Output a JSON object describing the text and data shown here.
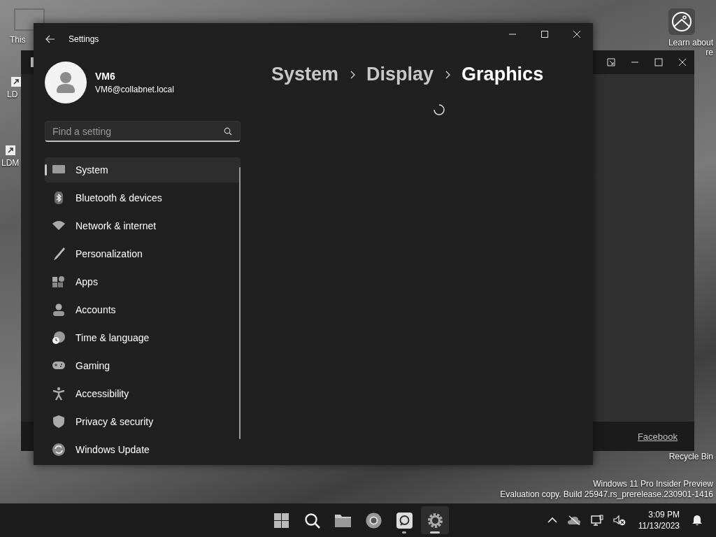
{
  "desktop": {
    "icons": [
      {
        "kind": "pc",
        "lines": [
          "This"
        ]
      },
      {
        "kind": "shortcut",
        "lines": [
          "LD"
        ]
      },
      {
        "kind": "shortcut",
        "lines": [
          "LDM"
        ]
      },
      {
        "kind": "spotlight",
        "lines": [
          "Learn about",
          "re"
        ]
      },
      {
        "kind": "hidden",
        "lines": [
          "Recycle Bin"
        ]
      }
    ],
    "build_info": [
      "Windows 11 Pro Insider Preview",
      "Evaluation copy. Build 25947.rs_prerelease.230901-1416"
    ]
  },
  "back_window": {
    "link": "Facebook"
  },
  "settings": {
    "title": "Settings",
    "user": {
      "name": "VM6",
      "email": "VM6@collabnet.local"
    },
    "search": {
      "placeholder": "Find a setting"
    },
    "nav": [
      {
        "label": "System",
        "selected": true
      },
      {
        "label": "Bluetooth & devices",
        "selected": false
      },
      {
        "label": "Network & internet",
        "selected": false
      },
      {
        "label": "Personalization",
        "selected": false
      },
      {
        "label": "Apps",
        "selected": false
      },
      {
        "label": "Accounts",
        "selected": false
      },
      {
        "label": "Time & language",
        "selected": false
      },
      {
        "label": "Gaming",
        "selected": false
      },
      {
        "label": "Accessibility",
        "selected": false
      },
      {
        "label": "Privacy & security",
        "selected": false
      },
      {
        "label": "Windows Update",
        "selected": false
      }
    ],
    "breadcrumb": [
      "System",
      "Display",
      "Graphics"
    ],
    "loading": true
  },
  "taskbar": {
    "apps": [
      {
        "kind": "start",
        "running": false,
        "selected": false
      },
      {
        "kind": "search",
        "running": false,
        "selected": false
      },
      {
        "kind": "files",
        "running": false,
        "selected": false
      },
      {
        "kind": "browser",
        "running": false,
        "selected": false
      },
      {
        "kind": "remote",
        "running": true,
        "selected": false
      },
      {
        "kind": "settings",
        "running": true,
        "selected": true
      }
    ],
    "time": "3:09 PM",
    "date": "11/13/2023"
  }
}
